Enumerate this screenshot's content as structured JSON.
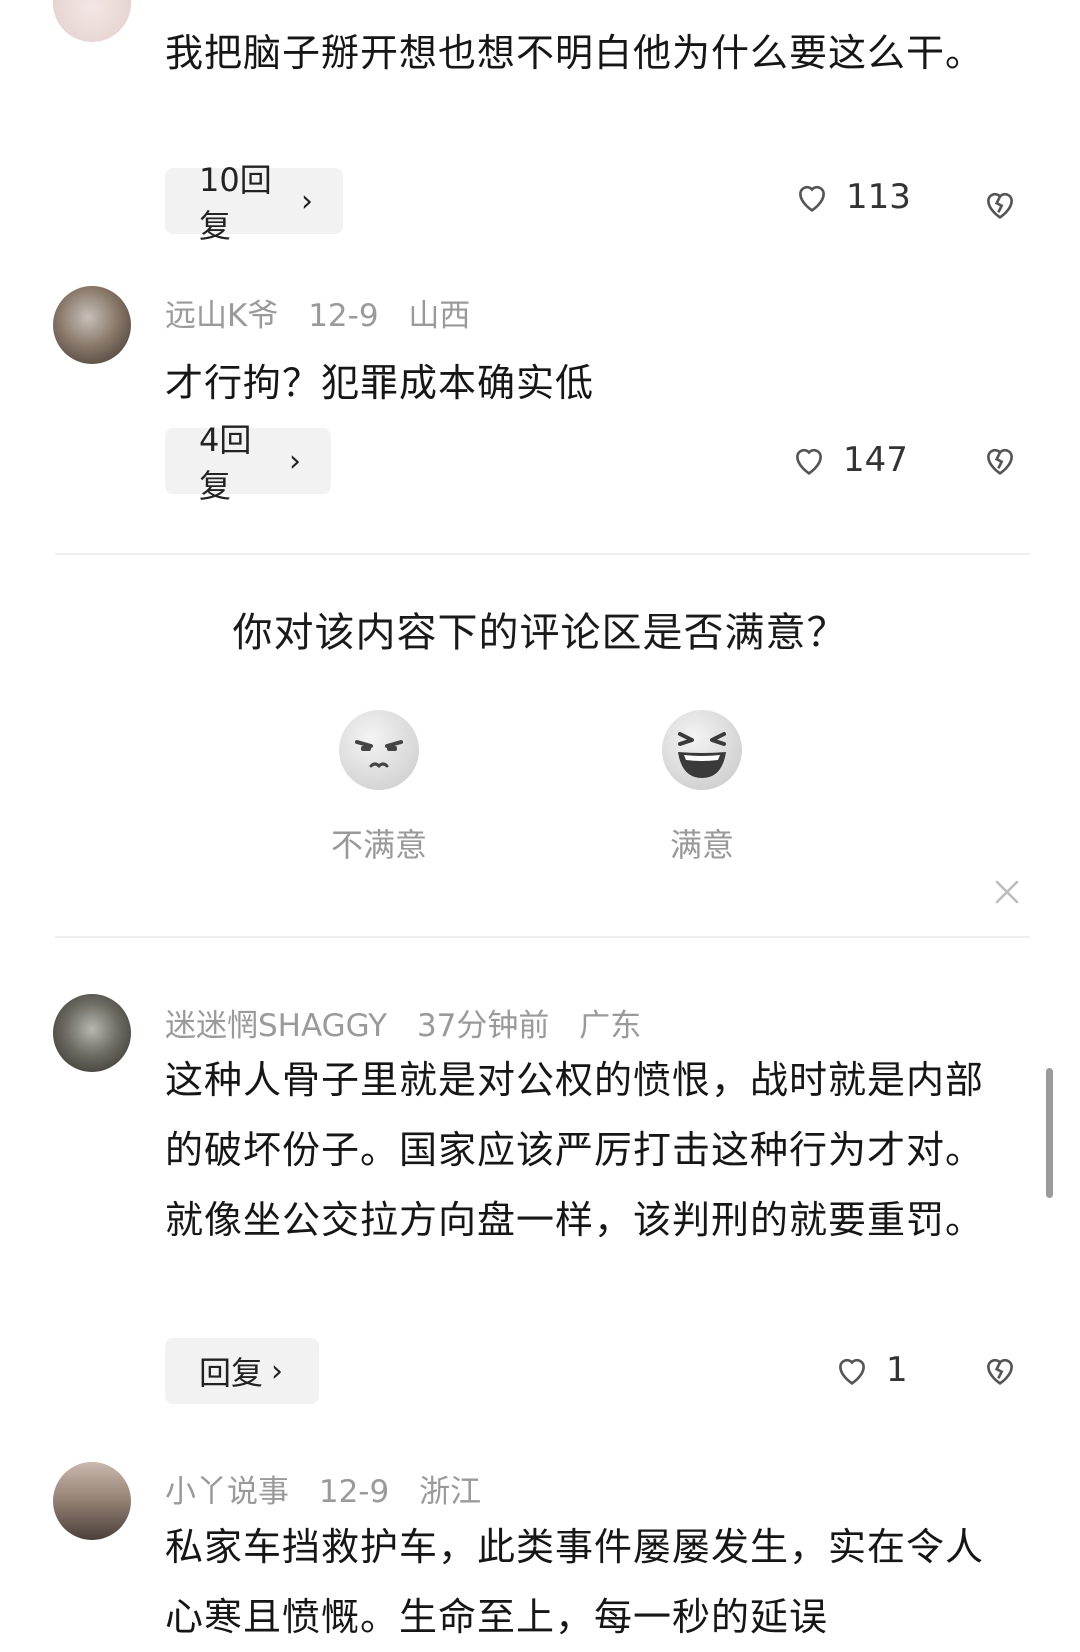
{
  "comments": [
    {
      "text": "我把脑子掰开想也想不明白他为什么要这么干。",
      "reply_label": "10回复",
      "likes": "113"
    },
    {
      "username": "远山K爷",
      "date": "12-9",
      "location": "山西",
      "text": "才行拘？犯罪成本确实低",
      "reply_label": "4回复",
      "likes": "147"
    },
    {
      "username": "迷迷惘SHAGGY",
      "date": "37分钟前",
      "location": "广东",
      "text": "这种人骨子里就是对公权的愤恨，战时就是内部的破坏份子。国家应该严厉打击这种行为才对。就像坐公交拉方向盘一样，该判刑的就要重罚。",
      "reply_label": "回复",
      "likes": "1"
    },
    {
      "username": "小丫说事",
      "date": "12-9",
      "location": "浙江",
      "text": "私家车挡救护车，此类事件屡屡发生，实在令人心寒且愤慨。生命至上，每一秒的延误"
    }
  ],
  "survey": {
    "question": "你对该内容下的评论区是否满意？",
    "option_unsatisfied": "不满意",
    "option_satisfied": "满意"
  },
  "icons": {
    "like": "heart-outline-icon",
    "dislike": "broken-heart-icon",
    "close": "close-x-icon",
    "chevron": "chevron-right-icon"
  }
}
